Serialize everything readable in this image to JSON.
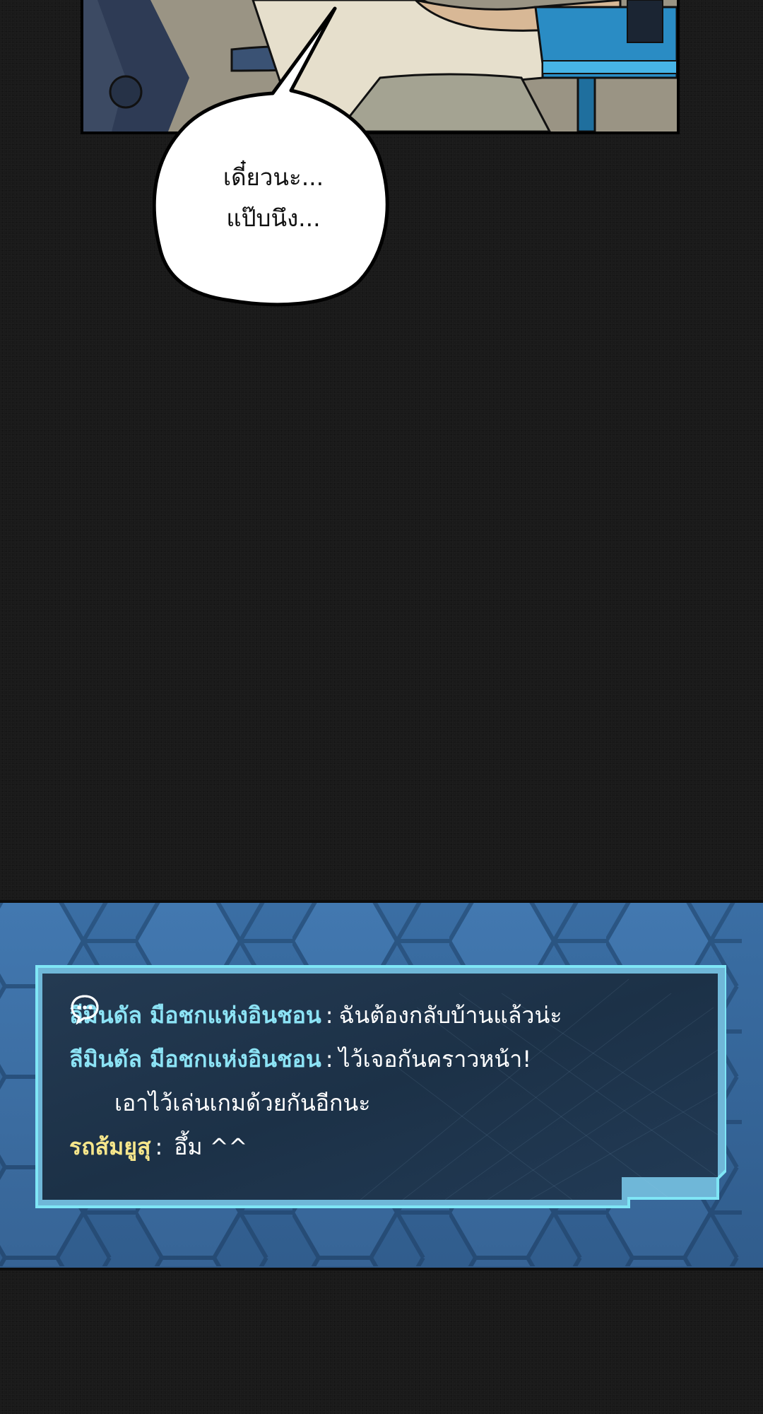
{
  "bubble": {
    "line1": "เดี๋ยวนะ...",
    "line2": "แป๊บนึง..."
  },
  "chat": {
    "messages": [
      {
        "sender": "ลีมินดัล มือชกแห่งอินชอน",
        "separator": ":",
        "text": "ฉันต้องกลับบ้านแล้วน่ะ"
      },
      {
        "sender": "ลีมินดัล มือชกแห่งอินชอน",
        "separator": ":",
        "text": "ไว้เจอกันคราวหน้า!"
      },
      {
        "continuation": "เอาไว้เล่นเกมด้วยกันอีกนะ"
      },
      {
        "sender": "รถส้มยูสุ",
        "separator": ":",
        "text": "อึ้ม ^^"
      }
    ]
  },
  "colors": {
    "background": "#1a1a1a",
    "banner_blue": "#3a6ea4",
    "chatbox_dark": "#1c3147",
    "chatbox_border": "#7fe6f6",
    "sender_cyan": "#8ce3f5",
    "sender_yellow": "#f6e68b"
  },
  "icons": {
    "chat": "speech-bubble-dots-icon"
  }
}
